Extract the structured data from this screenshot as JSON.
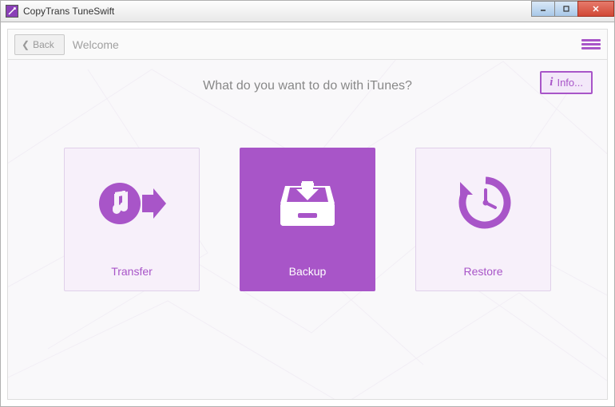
{
  "window": {
    "title": "CopyTrans TuneSwift"
  },
  "header": {
    "back_label": "Back",
    "page_name": "Welcome"
  },
  "main": {
    "question": "What do you want to do with iTunes?",
    "info_label": "Info..."
  },
  "tiles": {
    "transfer": {
      "label": "Transfer"
    },
    "backup": {
      "label": "Backup"
    },
    "restore": {
      "label": "Restore"
    }
  },
  "colors": {
    "accent": "#a855c8"
  }
}
